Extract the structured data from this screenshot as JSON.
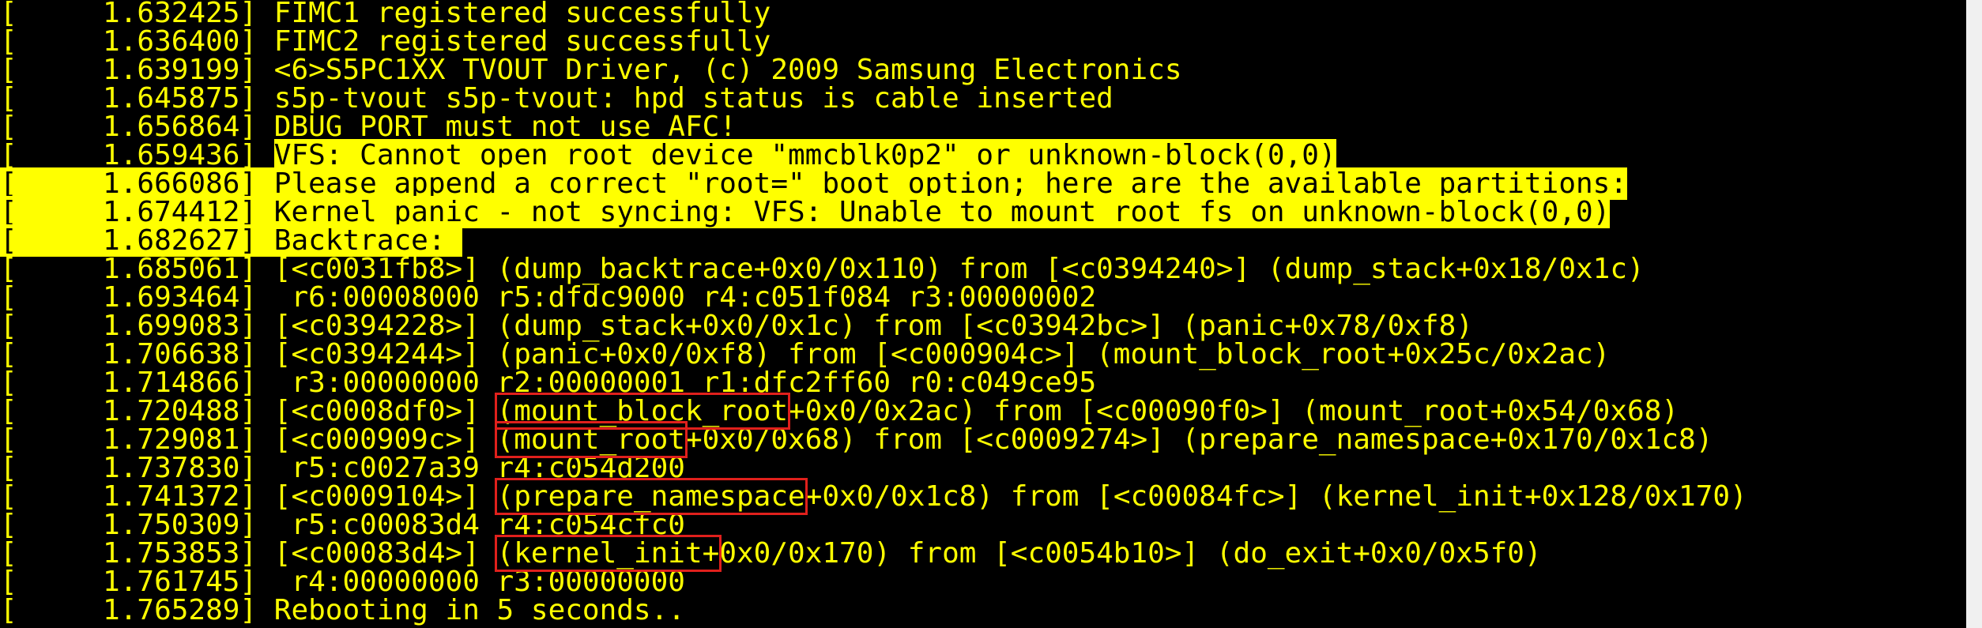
{
  "colors": {
    "background": "#000000",
    "text": "#ffff00",
    "highlight": "#ffff00",
    "highlight_text": "#000000",
    "annotation_box": "#e0201c"
  },
  "lines": [
    {
      "ts": "[     1.632425] ",
      "msg": [
        "FIMC1 registered successfully"
      ],
      "hl": "none"
    },
    {
      "ts": "[     1.636400] ",
      "msg": [
        "FIMC2 registered successfully"
      ],
      "hl": "none"
    },
    {
      "ts": "[     1.639199] ",
      "msg": [
        "<6>S5PC1XX TVOUT Driver, (c) 2009 Samsung Electronics"
      ],
      "hl": "none"
    },
    {
      "ts": "[     1.645875] ",
      "msg": [
        "s5p-tvout s5p-tvout: hpd status is cable inserted"
      ],
      "hl": "none"
    },
    {
      "ts": "[     1.656864] ",
      "msg": [
        "DBUG_PORT must not use AFC!"
      ],
      "hl": "none"
    },
    {
      "ts": "[     1.659436] ",
      "msg": [
        "VFS: Cannot open root device \"mmcblk0p2\" or unknown-block(0,0)"
      ],
      "hl": "text"
    },
    {
      "ts": "[     1.666086] ",
      "msg": [
        "Please append a correct \"root=\" boot option; here are the available partitions:"
      ],
      "hl": "full"
    },
    {
      "ts": "[     1.674412] ",
      "msg": [
        "Kernel panic - not syncing: VFS: Unable to mount root fs on unknown-block(0,0)"
      ],
      "hl": "full"
    },
    {
      "ts": "[     1.682627] ",
      "msg": [
        "Backtrace: "
      ],
      "hl": "full"
    },
    {
      "ts": "[     1.685061] ",
      "msg": [
        "[<c0031fb8>] (dump_backtrace+0x0/0x110) from [<c0394240>] (dump_stack+0x18/0x1c)"
      ],
      "hl": "none"
    },
    {
      "ts": "[     1.693464] ",
      "msg": [
        " r6:00008000 r5:dfdc9000 r4:c051f084 r3:00000002"
      ],
      "hl": "none"
    },
    {
      "ts": "[     1.699083] ",
      "msg": [
        "[<c0394228>] (dump_stack+0x0/0x1c) from [<c03942bc>] (panic+0x78/0xf8)"
      ],
      "hl": "none"
    },
    {
      "ts": "[     1.706638] ",
      "msg": [
        "[<c0394244>] (panic+0x0/0xf8) from [<c000904c>] (mount_block_root+0x25c/0x2ac)"
      ],
      "hl": "none"
    },
    {
      "ts": "[     1.714866] ",
      "msg": [
        " r3:00000000 r2:00000001 r1:dfc2ff60 r0:c049ce95"
      ],
      "hl": "none"
    },
    {
      "ts": "[     1.720488] ",
      "msg": [
        "[<c0008df0>] ",
        "(mount_block_root",
        "+0x0/0x2ac) from [<c00090f0>] (mount_root+0x54/0x68)"
      ],
      "hl": "none"
    },
    {
      "ts": "[     1.729081] ",
      "msg": [
        "[<c000909c>] ",
        "(mount_root",
        "+0x0/0x68) from [<c0009274>] (prepare_namespace+0x170/0x1c8)"
      ],
      "hl": "none"
    },
    {
      "ts": "[     1.737830] ",
      "msg": [
        " r5:c0027a39 r4:c054d200"
      ],
      "hl": "none"
    },
    {
      "ts": "[     1.741372] ",
      "msg": [
        "[<c0009104>] ",
        "(prepare_namespace",
        "+0x0/0x1c8) from [<c00084fc>] (kernel_init+0x128/0x170)"
      ],
      "hl": "none"
    },
    {
      "ts": "[     1.750309] ",
      "msg": [
        " r5:c00083d4 r4:c054cfc0"
      ],
      "hl": "none"
    },
    {
      "ts": "[     1.753853] ",
      "msg": [
        "[<c00083d4>] ",
        "(kernel_init+",
        "0x0/0x170) from [<c0054b10>] (do_exit+0x0/0x5f0)"
      ],
      "hl": "none"
    },
    {
      "ts": "[     1.761745] ",
      "msg": [
        " r4:00000000 r3:00000000"
      ],
      "hl": "none"
    },
    {
      "ts": "[     1.765289] ",
      "msg": [
        "Rebooting in 5 seconds.."
      ],
      "hl": "none"
    }
  ]
}
